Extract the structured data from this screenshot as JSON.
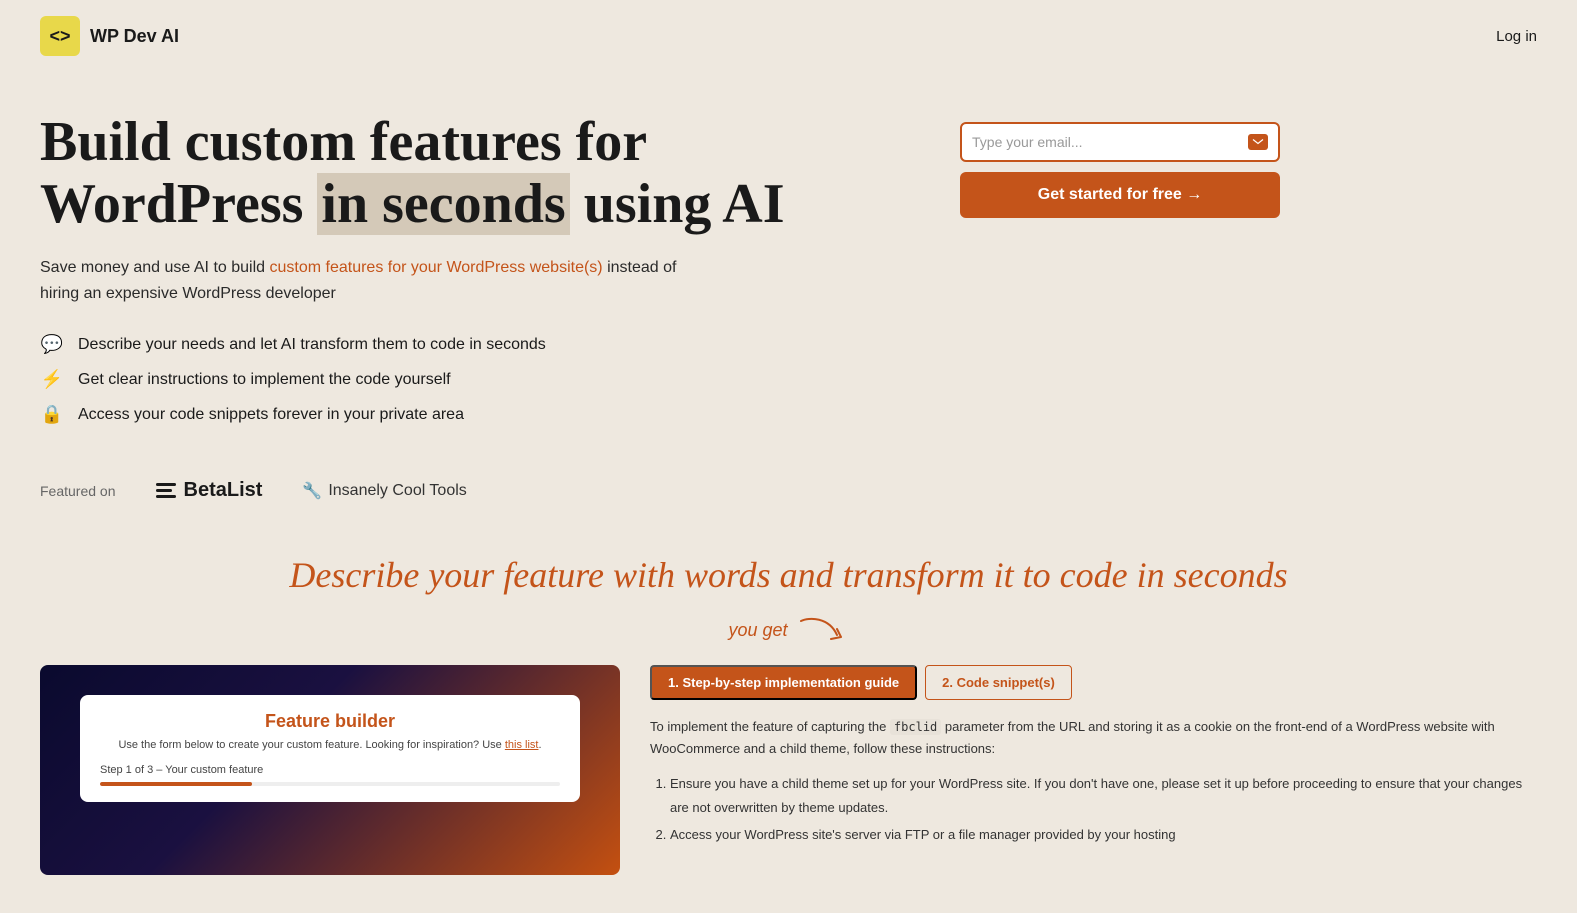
{
  "nav": {
    "brand_name": "WP Dev AI",
    "logo_symbol": "<>",
    "login_label": "Log in"
  },
  "hero": {
    "title_line1": "Build custom features for",
    "title_line2_plain": "WordPress ",
    "title_line2_highlight": "in seconds",
    "title_line2_end": " using AI",
    "subtitle": "Save money and use AI to build custom features for your WordPress website(s) instead of hiring an expensive WordPress developer",
    "features": [
      {
        "icon": "💬",
        "text": "Describe your needs and let AI transform them to code in seconds"
      },
      {
        "icon": "⚡",
        "text": "Get clear instructions to implement the code yourself"
      },
      {
        "icon": "🔒",
        "text": "Access your code snippets forever in your private area"
      }
    ],
    "email_placeholder": "Type your email...",
    "cta_label": "Get started for free →"
  },
  "featured": {
    "label": "Featured on",
    "betalist": "BetaList",
    "insanely_cool": "Insanely Cool Tools"
  },
  "section": {
    "describe_title": "Describe your feature with words and transform it to code in seconds",
    "you_get": "you get"
  },
  "demo": {
    "tabs": [
      "1. Step-by-step implementation guide",
      "2. Code snippet(s)"
    ],
    "card_title": "Feature builder",
    "card_subtitle": "Use the form below to create your custom feature. Looking for inspiration? Use this list.",
    "card_step": "Step 1 of 3 – Your custom feature",
    "description": "To implement the feature of capturing the fbclid parameter from the URL and storing it as a cookie on the front-end of a WordPress website with WooCommerce and a child theme, follow these instructions:",
    "list_items": [
      "Ensure you have a child theme set up for your WordPress site. If you don't have one, please set it up before proceeding to ensure that your changes are not overwritten by theme updates.",
      "Access your WordPress site's server via FTP or a file manager provided by your hosting"
    ],
    "code_snippet": "fbclid"
  }
}
